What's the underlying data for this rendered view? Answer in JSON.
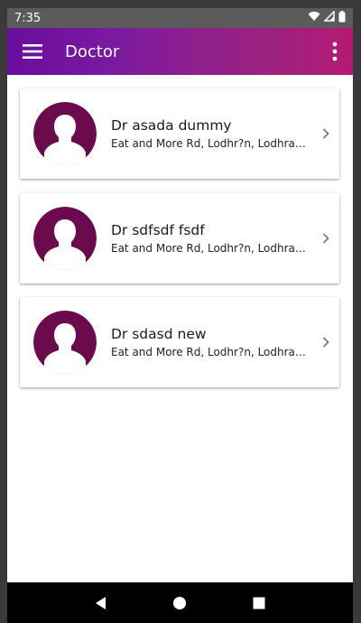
{
  "status_bar": {
    "time": "7:35",
    "icons": [
      "wifi-icon",
      "signal-icon",
      "battery-icon"
    ]
  },
  "app_bar": {
    "title": "Doctor",
    "menu_icon": "hamburger-menu-icon",
    "overflow_icon": "more-vert-icon",
    "gradient": [
      "#6a0d9d",
      "#b51a74"
    ]
  },
  "doctors": [
    {
      "name": "Dr asada dummy",
      "address": "Eat and More Rd, Lodhr?n, Lodhran, Pakistan"
    },
    {
      "name": "Dr sdfsdf fsdf",
      "address": "Eat and More Rd, Lodhr?n, Lodhran, Pakistan"
    },
    {
      "name": "Dr sdasd new",
      "address": "Eat and More Rd, Lodhr?n, Lodhran, Pakistan"
    }
  ],
  "colors": {
    "avatar": "#6b0a4c",
    "chevron": "#7a7a7a"
  },
  "nav_bar": {
    "icons": [
      "back-icon",
      "home-icon",
      "recents-icon"
    ]
  }
}
